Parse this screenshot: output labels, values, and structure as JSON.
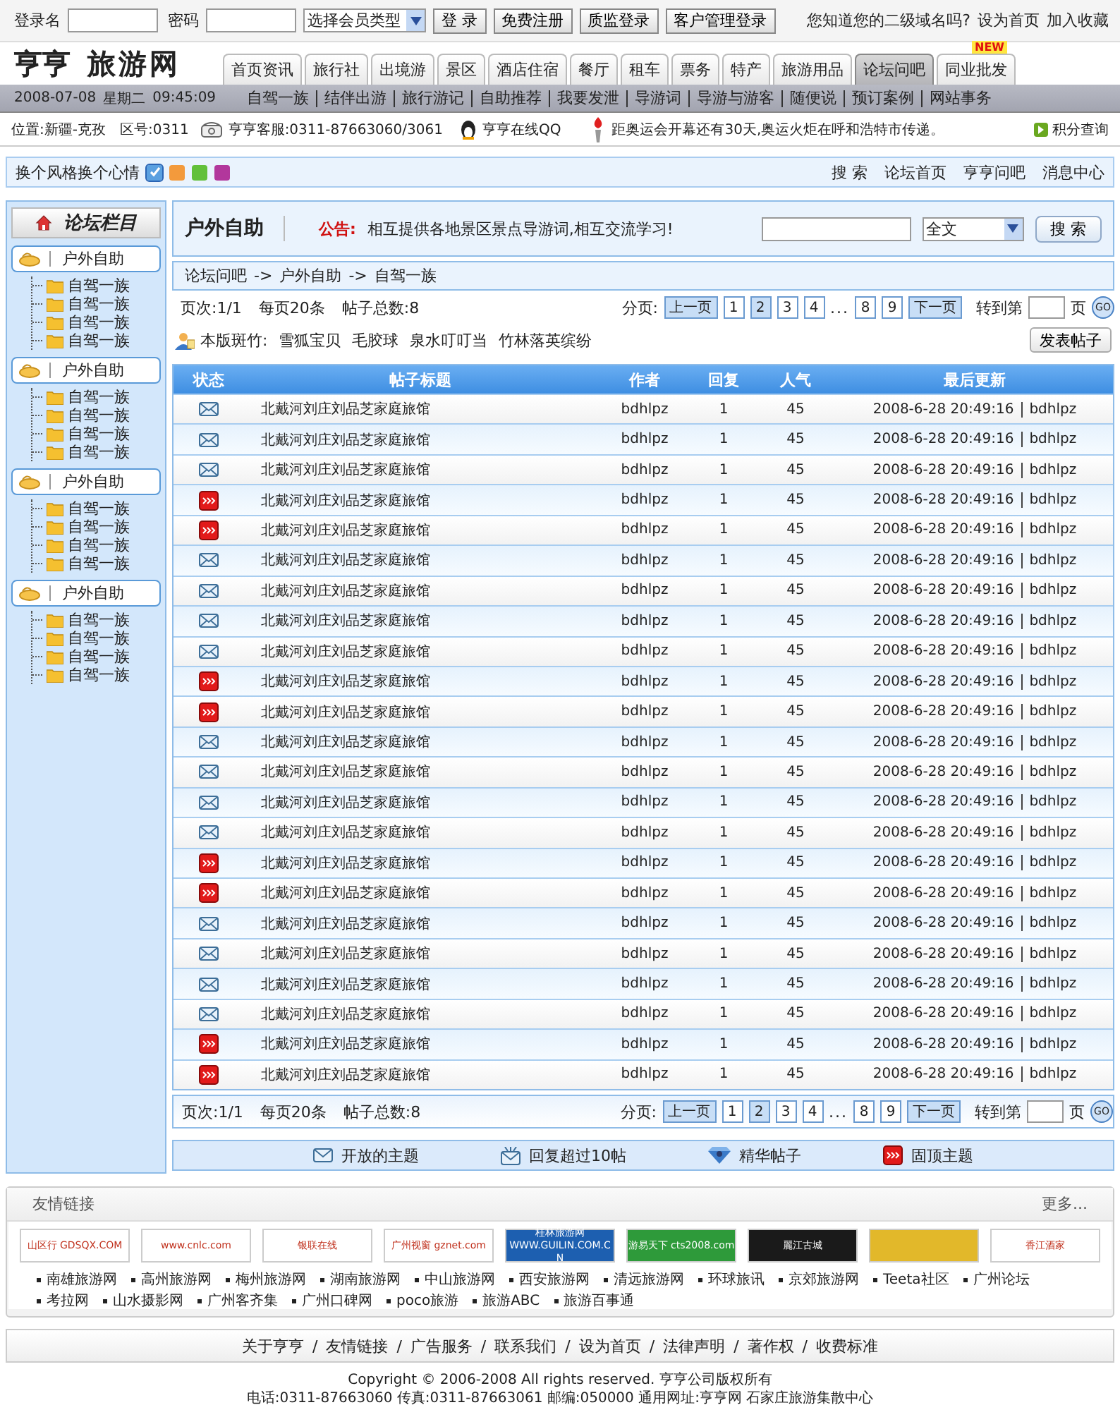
{
  "login": {
    "user_label": "登录名",
    "password_label": "密码",
    "member_type": "选择会员类型",
    "buttons": [
      "登 录",
      "免费注册",
      "质监登录",
      "客户管理登录"
    ],
    "question": "您知道您的二级域名吗?",
    "links": [
      "设为首页",
      "加入收藏"
    ]
  },
  "logo": {
    "first": "亨亨",
    "second": "旅游网"
  },
  "tabs": [
    {
      "label": "首页资讯",
      "selected": false
    },
    {
      "label": "旅行社",
      "selected": false
    },
    {
      "label": "出境游",
      "selected": false
    },
    {
      "label": "景区",
      "selected": false
    },
    {
      "label": "酒店住宿",
      "selected": false
    },
    {
      "label": "餐厅",
      "selected": false
    },
    {
      "label": "租车",
      "selected": false
    },
    {
      "label": "票务",
      "selected": false
    },
    {
      "label": "特产",
      "selected": false
    },
    {
      "label": "旅游用品",
      "selected": false
    },
    {
      "label": "论坛问吧",
      "selected": true
    },
    {
      "label": "同业批发",
      "selected": false,
      "badge": "NEW"
    }
  ],
  "subnav": {
    "date": "2008-07-08",
    "weekday": "星期二",
    "time": "09:45:09",
    "links": [
      "自驾一族",
      "结伴出游",
      "旅行游记",
      "自助推荐",
      "我要发泄",
      "导游词",
      "导游与游客",
      "随便说",
      "预订案例",
      "网站事务"
    ]
  },
  "info": {
    "location": "位置:新疆-克孜",
    "area_code": "区号:0311",
    "hotline": "亨亨客服:0311-87663060/3061",
    "qq": "亨亨在线QQ",
    "notice": "距奥运会开幕还有30天,奥运火炬在呼和浩特市传递。",
    "points": "积分查询"
  },
  "style_bar": {
    "label": "换个风格换个心情",
    "swatches": [
      {
        "color": "#5aa0e0",
        "selected": true
      },
      {
        "color": "#f39a3c",
        "selected": false
      },
      {
        "color": "#62c03a",
        "selected": false
      },
      {
        "color": "#b2379c",
        "selected": false
      }
    ],
    "links": [
      "搜 索",
      "论坛首页",
      "亨亨问吧",
      "消息中心"
    ]
  },
  "sidebar": {
    "title": "论坛栏目",
    "groups": [
      {
        "label": "户外自助",
        "children": [
          {
            "label": "自驾一族"
          },
          {
            "label": "自驾一族"
          },
          {
            "label": "自驾一族"
          },
          {
            "label": "自驾一族"
          }
        ]
      },
      {
        "label": "户外自助",
        "children": [
          {
            "label": "自驾一族"
          },
          {
            "label": "自驾一族"
          },
          {
            "label": "自驾一族"
          },
          {
            "label": "自驾一族"
          }
        ]
      },
      {
        "label": "户外自助",
        "children": [
          {
            "label": "自驾一族"
          },
          {
            "label": "自驾一族"
          },
          {
            "label": "自驾一族"
          },
          {
            "label": "自驾一族"
          }
        ]
      },
      {
        "label": "户外自助",
        "children": [
          {
            "label": "自驾一族"
          },
          {
            "label": "自驾一族"
          },
          {
            "label": "自驾一族"
          },
          {
            "label": "自驾一族"
          }
        ]
      }
    ]
  },
  "forum": {
    "title": "户外自助",
    "notice_label": "公告:",
    "notice": "相互提供各地景区景点导游词,相互交流学习!",
    "search_scope": "全文",
    "search_button": "搜 索",
    "breadcrumb": [
      "论坛问吧",
      "户外自助",
      "自驾一族"
    ],
    "breadcrumb_separator": "->"
  },
  "pagers": [
    {
      "page": "页次:1/1",
      "per_page": "每页20条",
      "total": "帖子总数:8",
      "label": "分页:",
      "prev": "上一页",
      "pages_before": [
        {
          "label": "1",
          "selected": false
        },
        {
          "label": "2",
          "selected": true
        },
        {
          "label": "3",
          "selected": false
        },
        {
          "label": "4",
          "selected": false
        }
      ],
      "ellipsis": "...",
      "pages_after": [
        {
          "label": "8",
          "selected": false
        },
        {
          "label": "9",
          "selected": false
        }
      ],
      "next": "下一页",
      "goto": "转到第",
      "goto_unit": "页",
      "go": "GO"
    },
    {
      "page": "页次:1/1",
      "per_page": "每页20条",
      "total": "帖子总数:8",
      "label": "分页:",
      "prev": "上一页",
      "pages_before": [
        {
          "label": "1",
          "selected": false
        },
        {
          "label": "2",
          "selected": true
        },
        {
          "label": "3",
          "selected": false
        },
        {
          "label": "4",
          "selected": false
        }
      ],
      "ellipsis": "...",
      "pages_after": [
        {
          "label": "8",
          "selected": false
        },
        {
          "label": "9",
          "selected": false
        }
      ],
      "next": "下一页",
      "goto": "转到第",
      "goto_unit": "页",
      "go": "GO"
    }
  ],
  "moderators": {
    "label": "本版斑竹:",
    "names": [
      "雪狐宝贝",
      "毛胶球",
      "泉水叮叮当",
      "竹林落英缤纷"
    ]
  },
  "post_button": "发表帖子",
  "table": {
    "columns": [
      "状态",
      "帖子标题",
      "作者",
      "回复",
      "人气",
      "最后更新"
    ],
    "rows": [
      {
        "kind": "open",
        "title": "北戴河刘庄刘品芝家庭旅馆",
        "author": "bdhlpz",
        "replies": "1",
        "views": "45",
        "updated": "2008-6-28 20:49:16",
        "last_user": "bdhlpz"
      },
      {
        "kind": "open",
        "title": "北戴河刘庄刘品芝家庭旅馆",
        "author": "bdhlpz",
        "replies": "1",
        "views": "45",
        "updated": "2008-6-28 20:49:16",
        "last_user": "bdhlpz"
      },
      {
        "kind": "open",
        "title": "北戴河刘庄刘品芝家庭旅馆",
        "author": "bdhlpz",
        "replies": "1",
        "views": "45",
        "updated": "2008-6-28 20:49:16",
        "last_user": "bdhlpz"
      },
      {
        "kind": "pinned",
        "title": "北戴河刘庄刘品芝家庭旅馆",
        "author": "bdhlpz",
        "replies": "1",
        "views": "45",
        "updated": "2008-6-28 20:49:16",
        "last_user": "bdhlpz"
      },
      {
        "kind": "pinned",
        "title": "北戴河刘庄刘品芝家庭旅馆",
        "author": "bdhlpz",
        "replies": "1",
        "views": "45",
        "updated": "2008-6-28 20:49:16",
        "last_user": "bdhlpz"
      },
      {
        "kind": "open",
        "title": "北戴河刘庄刘品芝家庭旅馆",
        "author": "bdhlpz",
        "replies": "1",
        "views": "45",
        "updated": "2008-6-28 20:49:16",
        "last_user": "bdhlpz"
      },
      {
        "kind": "open",
        "title": "北戴河刘庄刘品芝家庭旅馆",
        "author": "bdhlpz",
        "replies": "1",
        "views": "45",
        "updated": "2008-6-28 20:49:16",
        "last_user": "bdhlpz"
      },
      {
        "kind": "open",
        "title": "北戴河刘庄刘品芝家庭旅馆",
        "author": "bdhlpz",
        "replies": "1",
        "views": "45",
        "updated": "2008-6-28 20:49:16",
        "last_user": "bdhlpz"
      },
      {
        "kind": "open",
        "title": "北戴河刘庄刘品芝家庭旅馆",
        "author": "bdhlpz",
        "replies": "1",
        "views": "45",
        "updated": "2008-6-28 20:49:16",
        "last_user": "bdhlpz"
      },
      {
        "kind": "pinned",
        "title": "北戴河刘庄刘品芝家庭旅馆",
        "author": "bdhlpz",
        "replies": "1",
        "views": "45",
        "updated": "2008-6-28 20:49:16",
        "last_user": "bdhlpz"
      },
      {
        "kind": "pinned",
        "title": "北戴河刘庄刘品芝家庭旅馆",
        "author": "bdhlpz",
        "replies": "1",
        "views": "45",
        "updated": "2008-6-28 20:49:16",
        "last_user": "bdhlpz"
      },
      {
        "kind": "open",
        "title": "北戴河刘庄刘品芝家庭旅馆",
        "author": "bdhlpz",
        "replies": "1",
        "views": "45",
        "updated": "2008-6-28 20:49:16",
        "last_user": "bdhlpz"
      },
      {
        "kind": "open",
        "title": "北戴河刘庄刘品芝家庭旅馆",
        "author": "bdhlpz",
        "replies": "1",
        "views": "45",
        "updated": "2008-6-28 20:49:16",
        "last_user": "bdhlpz"
      },
      {
        "kind": "open",
        "title": "北戴河刘庄刘品芝家庭旅馆",
        "author": "bdhlpz",
        "replies": "1",
        "views": "45",
        "updated": "2008-6-28 20:49:16",
        "last_user": "bdhlpz"
      },
      {
        "kind": "open",
        "title": "北戴河刘庄刘品芝家庭旅馆",
        "author": "bdhlpz",
        "replies": "1",
        "views": "45",
        "updated": "2008-6-28 20:49:16",
        "last_user": "bdhlpz"
      },
      {
        "kind": "pinned",
        "title": "北戴河刘庄刘品芝家庭旅馆",
        "author": "bdhlpz",
        "replies": "1",
        "views": "45",
        "updated": "2008-6-28 20:49:16",
        "last_user": "bdhlpz"
      },
      {
        "kind": "pinned",
        "title": "北戴河刘庄刘品芝家庭旅馆",
        "author": "bdhlpz",
        "replies": "1",
        "views": "45",
        "updated": "2008-6-28 20:49:16",
        "last_user": "bdhlpz"
      },
      {
        "kind": "open",
        "title": "北戴河刘庄刘品芝家庭旅馆",
        "author": "bdhlpz",
        "replies": "1",
        "views": "45",
        "updated": "2008-6-28 20:49:16",
        "last_user": "bdhlpz"
      },
      {
        "kind": "open",
        "title": "北戴河刘庄刘品芝家庭旅馆",
        "author": "bdhlpz",
        "replies": "1",
        "views": "45",
        "updated": "2008-6-28 20:49:16",
        "last_user": "bdhlpz"
      },
      {
        "kind": "open",
        "title": "北戴河刘庄刘品芝家庭旅馆",
        "author": "bdhlpz",
        "replies": "1",
        "views": "45",
        "updated": "2008-6-28 20:49:16",
        "last_user": "bdhlpz"
      },
      {
        "kind": "open",
        "title": "北戴河刘庄刘品芝家庭旅馆",
        "author": "bdhlpz",
        "replies": "1",
        "views": "45",
        "updated": "2008-6-28 20:49:16",
        "last_user": "bdhlpz"
      },
      {
        "kind": "pinned",
        "title": "北戴河刘庄刘品芝家庭旅馆",
        "author": "bdhlpz",
        "replies": "1",
        "views": "45",
        "updated": "2008-6-28 20:49:16",
        "last_user": "bdhlpz"
      },
      {
        "kind": "pinned",
        "title": "北戴河刘庄刘品芝家庭旅馆",
        "author": "bdhlpz",
        "replies": "1",
        "views": "45",
        "updated": "2008-6-28 20:49:16",
        "last_user": "bdhlpz"
      }
    ]
  },
  "legend": [
    {
      "kind": "open",
      "label": "开放的主题"
    },
    {
      "kind": "hot",
      "label": "回复超过10帖"
    },
    {
      "kind": "elite",
      "label": "精华帖子"
    },
    {
      "kind": "pinned",
      "label": "固顶主题"
    }
  ],
  "links_box": {
    "title": "友情链接",
    "more": "更多...",
    "logos": [
      {
        "text": "山区行 GDSQX.COM",
        "color": "#ffffff"
      },
      {
        "text": "www.cnlc.com",
        "color": "#ffffff"
      },
      {
        "text": "银联在线",
        "color": "#ffffff"
      },
      {
        "text": "广州视窗 gznet.com",
        "color": "#ffffff"
      },
      {
        "text": "桂林旅游网 WWW.GUILIN.COM.CN",
        "color": "#1d5fb0"
      },
      {
        "text": "游易天下 cts2008.com",
        "color": "#2e9a3a"
      },
      {
        "text": "麗江古城",
        "color": "#1a1a1a"
      },
      {
        "color": "#e2b82a"
      },
      {
        "text": "香江酒家",
        "color": "#ffffff"
      }
    ],
    "sites": [
      "南雄旅游网",
      "高州旅游网",
      "梅州旅游网",
      "湖南旅游网",
      "中山旅游网",
      "西安旅游网",
      "清远旅游网",
      "环球旅讯",
      "京郊旅游网",
      "Teeta社区",
      "广州论坛",
      "考拉网",
      "山水摄影网",
      "广州客齐集",
      "广州口碑网",
      "poco旅游",
      "旅游ABC",
      "旅游百事通"
    ]
  },
  "footer": {
    "links": [
      "关于亨亨",
      "友情链接",
      "广告服务",
      "联系我们",
      "设为首页",
      "法律声明",
      "著作权",
      "收费标准"
    ],
    "separator": "/",
    "lines": [
      "Copyright © 2006-2008 All rights reserved. 亨亨公司版权所有",
      "电话:0311-87663060 传真:0311-87663061 邮编:050000 通用网址:亨亨网 石家庄旅游集散中心"
    ]
  }
}
